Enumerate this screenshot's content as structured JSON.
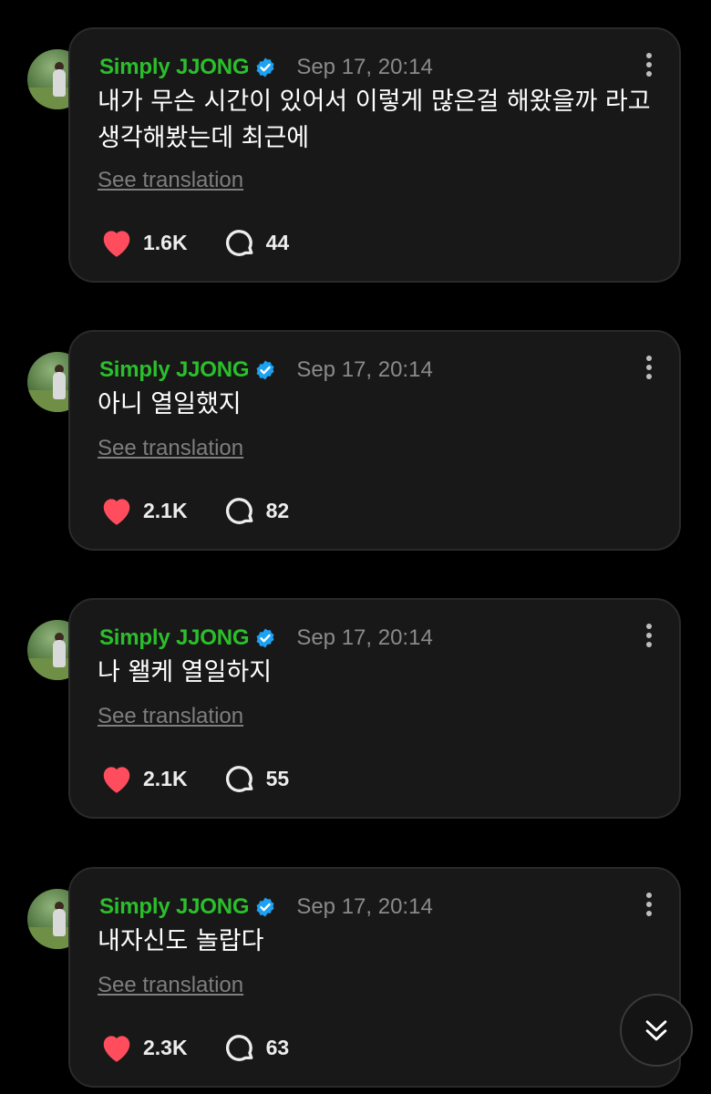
{
  "posts": [
    {
      "author": "Simply JJONG",
      "time": "Sep 17, 20:14",
      "text": "내가 무슨 시간이 있어서 이렇게 많은걸 해왔을까 라고 생각해봤는데 최근에",
      "translate_label": "See translation",
      "likes": "1.6K",
      "replies": "44"
    },
    {
      "author": "Simply JJONG",
      "time": "Sep 17, 20:14",
      "text": "아니 열일했지",
      "translate_label": "See translation",
      "likes": "2.1K",
      "replies": "82"
    },
    {
      "author": "Simply JJONG",
      "time": "Sep 17, 20:14",
      "text": "나 왤케 열일하지",
      "translate_label": "See translation",
      "likes": "2.1K",
      "replies": "55"
    },
    {
      "author": "Simply JJONG",
      "time": "Sep 17, 20:14",
      "text": "내자신도 놀랍다",
      "translate_label": "See translation",
      "likes": "2.3K",
      "replies": "63"
    }
  ],
  "icons": {
    "verified": "verified-badge-icon",
    "more": "more-vertical-icon",
    "like": "heart-icon",
    "reply": "comment-bubble-icon",
    "scroll": "double-chevron-down-icon"
  },
  "colors": {
    "background": "#000000",
    "card": "#181818",
    "author": "#2bbf2b",
    "heart": "#ff4d5e",
    "verified": "#1da1f2"
  }
}
